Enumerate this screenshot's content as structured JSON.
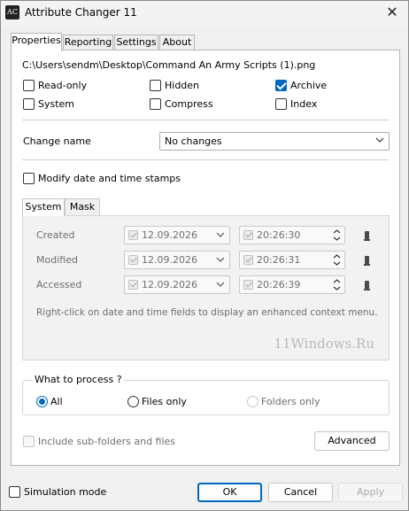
{
  "window": {
    "title": "Attribute Changer 11",
    "icon_text": "AC",
    "close_glyph": "✕"
  },
  "tabs": [
    {
      "label": "Properties",
      "active": true
    },
    {
      "label": "Reporting",
      "active": false
    },
    {
      "label": "Settings",
      "active": false
    },
    {
      "label": "About",
      "active": false
    }
  ],
  "properties": {
    "file_path": "C:\\Users\\sendm\\Desktop\\Command An Army Scripts (1).png",
    "attributes": [
      {
        "label": "Read-only",
        "checked": false
      },
      {
        "label": "Hidden",
        "checked": false
      },
      {
        "label": "Archive",
        "checked": true
      },
      {
        "label": "System",
        "checked": false
      },
      {
        "label": "Compress",
        "checked": false
      },
      {
        "label": "Index",
        "checked": false
      }
    ],
    "change_name": {
      "label": "Change name",
      "value": "No changes"
    },
    "modify_dates": {
      "label": "Modify date and time stamps",
      "checked": false
    },
    "subtabs": [
      {
        "label": "System",
        "active": true
      },
      {
        "label": "Mask",
        "active": false
      }
    ],
    "dates": [
      {
        "label": "Created",
        "date": "12.09.2026",
        "time": "20:26:30"
      },
      {
        "label": "Modified",
        "date": "12.09.2026",
        "time": "20:26:31"
      },
      {
        "label": "Accessed",
        "date": "12.09.2026",
        "time": "20:26:39"
      }
    ],
    "hint": "Right-click on date and time fields to display an enhanced context menu.",
    "watermark": "11Windows.Ru",
    "what_to_process": {
      "title": "What to process ?",
      "options": [
        {
          "label": "All",
          "checked": true,
          "enabled": true
        },
        {
          "label": "Files only",
          "checked": false,
          "enabled": true
        },
        {
          "label": "Folders only",
          "checked": false,
          "enabled": false
        }
      ]
    },
    "include_subfolders": {
      "label": "Include sub-folders and files",
      "checked": false,
      "enabled": false
    },
    "advanced_label": "Advanced"
  },
  "footer": {
    "simulation": {
      "label": "Simulation mode",
      "checked": false
    },
    "ok_label": "OK",
    "cancel_label": "Cancel",
    "apply_label": "Apply"
  },
  "colors": {
    "accent": "#0067c0"
  }
}
